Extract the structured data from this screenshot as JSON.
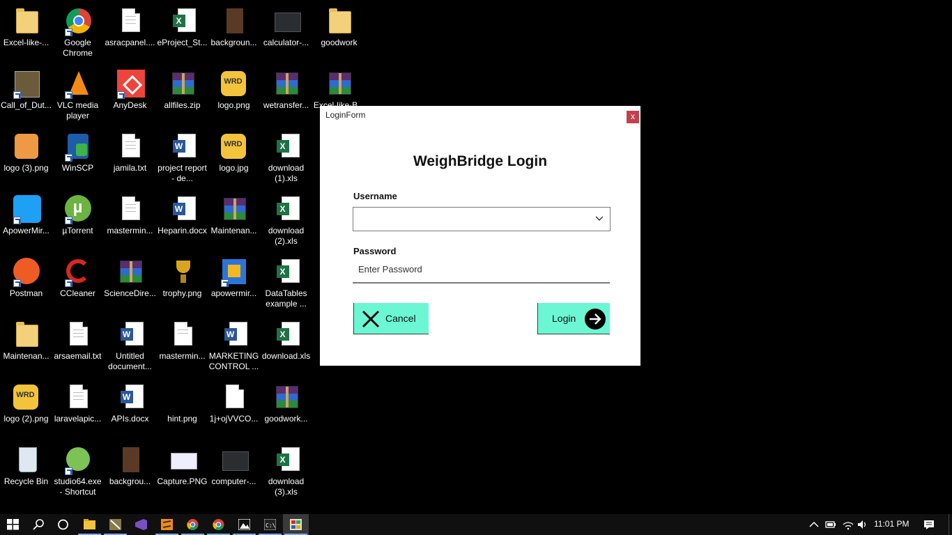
{
  "desktop": {
    "icons": [
      {
        "label": "Excel-like-..."
      },
      {
        "label": "Google Chrome"
      },
      {
        "label": "asracpanel...."
      },
      {
        "label": "eProject_St..."
      },
      {
        "label": "backgroun..."
      },
      {
        "label": "calculator-..."
      },
      {
        "label": "goodwork"
      },
      {
        "label": "Call_of_Dut..."
      },
      {
        "label": "VLC media player"
      },
      {
        "label": "AnyDesk"
      },
      {
        "label": "allfiles.zip"
      },
      {
        "label": "logo.png"
      },
      {
        "label": "wetransfer..."
      },
      {
        "label": "Excel-like-B..."
      },
      {
        "label": "logo (3).png"
      },
      {
        "label": "WinSCP"
      },
      {
        "label": "jamila.txt"
      },
      {
        "label": "project report - de..."
      },
      {
        "label": "logo.jpg"
      },
      {
        "label": "download (1).xls"
      },
      {
        "label": "ApowerMir..."
      },
      {
        "label": "µTorrent"
      },
      {
        "label": "mastermin..."
      },
      {
        "label": "Heparin.docx"
      },
      {
        "label": "Maintenan..."
      },
      {
        "label": "download (2).xls"
      },
      {
        "label": "Postman"
      },
      {
        "label": "CCleaner"
      },
      {
        "label": "ScienceDire..."
      },
      {
        "label": "trophy.png"
      },
      {
        "label": "apowermir..."
      },
      {
        "label": "DataTables example ..."
      },
      {
        "label": "Maintenan..."
      },
      {
        "label": "arsaemail.txt"
      },
      {
        "label": "Untitled document..."
      },
      {
        "label": "mastermin..."
      },
      {
        "label": "MARKETING CONTROL ..."
      },
      {
        "label": "download.xls"
      },
      {
        "label": "logo (2).png"
      },
      {
        "label": "laravelapic..."
      },
      {
        "label": "APIs.docx"
      },
      {
        "label": "hint.png"
      },
      {
        "label": "1j+ojVVCO..."
      },
      {
        "label": "goodwork..."
      },
      {
        "label": "Recycle Bin"
      },
      {
        "label": "studio64.exe - Shortcut"
      },
      {
        "label": "backgrou..."
      },
      {
        "label": "Capture.PNG"
      },
      {
        "label": "computer-..."
      },
      {
        "label": "download (3).xls"
      }
    ]
  },
  "login_form": {
    "window_title": "LoginForm",
    "close_label": "x",
    "heading": "WeighBridge Login",
    "username_label": "Username",
    "username_value": "",
    "password_label": "Password",
    "password_placeholder": "Enter Password",
    "cancel_label": "Cancel",
    "login_label": "Login",
    "accent_color": "#6bf7d4"
  },
  "taskbar": {
    "clock": "11:01 PM",
    "apps": [
      "start",
      "search",
      "task-view",
      "file-explorer",
      "app",
      "visual-studio",
      "sublime-text",
      "chrome",
      "chrome",
      "photos",
      "cmd",
      "weighbridge-app"
    ]
  }
}
